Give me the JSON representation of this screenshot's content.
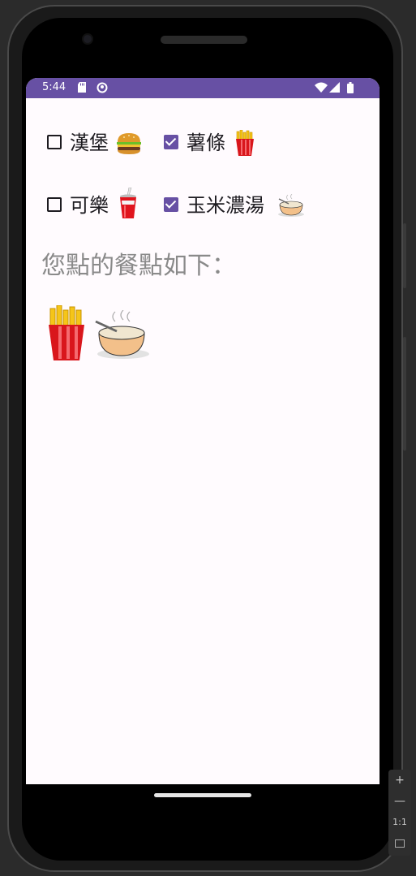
{
  "status_bar": {
    "time": "5:44",
    "icons": [
      "sd-card-icon",
      "sync-icon",
      "wifi-icon",
      "signal-icon",
      "battery-icon"
    ]
  },
  "options": [
    {
      "label": "漢堡",
      "emoji": "burger",
      "checked": false
    },
    {
      "label": "薯條",
      "emoji": "fries",
      "checked": true
    },
    {
      "label": "可樂",
      "emoji": "cola",
      "checked": false
    },
    {
      "label": "玉米濃湯",
      "emoji": "soup",
      "checked": true
    }
  ],
  "summary_label": "您點的餐點如下：",
  "ordered_items": [
    "fries",
    "soup"
  ],
  "emulator_zoom": {
    "plus": "+",
    "minus": "—",
    "ratio": "1:1"
  },
  "colors": {
    "primary": "#6750a4",
    "background": "#fffbfe",
    "summary_text": "#8a8a8a"
  }
}
